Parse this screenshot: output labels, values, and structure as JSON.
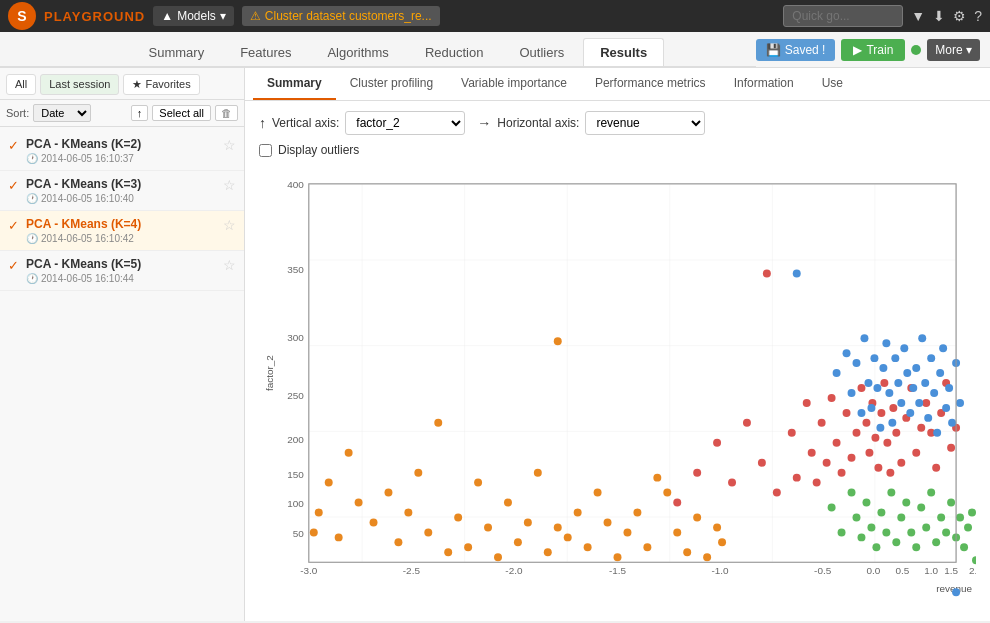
{
  "topbar": {
    "logo": "S",
    "playground": "PLAYGROUND",
    "models_label": "Models",
    "dataset_label": "Cluster dataset customers_re...",
    "quickgo_placeholder": "Quick go...",
    "icons": [
      "filter",
      "download",
      "settings",
      "help"
    ]
  },
  "navtabs": {
    "items": [
      "Summary",
      "Features",
      "Algorithms",
      "Reduction",
      "Outliers",
      "Results"
    ],
    "active": "Results",
    "saved_label": "Saved !",
    "train_label": "Train",
    "more_label": "More ▾"
  },
  "sidebar": {
    "tabs": [
      "All",
      "Last session",
      "Favorites"
    ],
    "active_tab": "Last session",
    "sort_label": "Sort:",
    "sort_value": "Date",
    "select_all_label": "Select all",
    "models": [
      {
        "name": "PCA - KMeans (K=2)",
        "date": "2014-06-05 16:10:37",
        "checked": true,
        "selected": false
      },
      {
        "name": "PCA - KMeans (K=3)",
        "date": "2014-06-05 16:10:40",
        "checked": true,
        "selected": false
      },
      {
        "name": "PCA - KMeans (K=4)",
        "date": "2014-06-05 16:10:42",
        "checked": true,
        "selected": true
      },
      {
        "name": "PCA - KMeans (K=5)",
        "date": "2014-06-05 16:10:44",
        "checked": true,
        "selected": false
      }
    ]
  },
  "subtabs": {
    "items": [
      "Summary",
      "Cluster profiling",
      "Variable importance",
      "Performance metrics",
      "Information",
      "Use"
    ],
    "active": "Summary"
  },
  "chart": {
    "vertical_axis_label": "Vertical axis:",
    "vertical_axis_value": "factor_2",
    "horizontal_axis_label": "Horizontal axis:",
    "horizontal_axis_value": "revenue",
    "outliers_label": "Display outliers",
    "y_axis_name": "factor_2",
    "x_axis_name": "revenue",
    "colors": {
      "orange": "#e88820",
      "red": "#d9534f",
      "blue": "#4a90d9",
      "green": "#5cb85c"
    }
  }
}
